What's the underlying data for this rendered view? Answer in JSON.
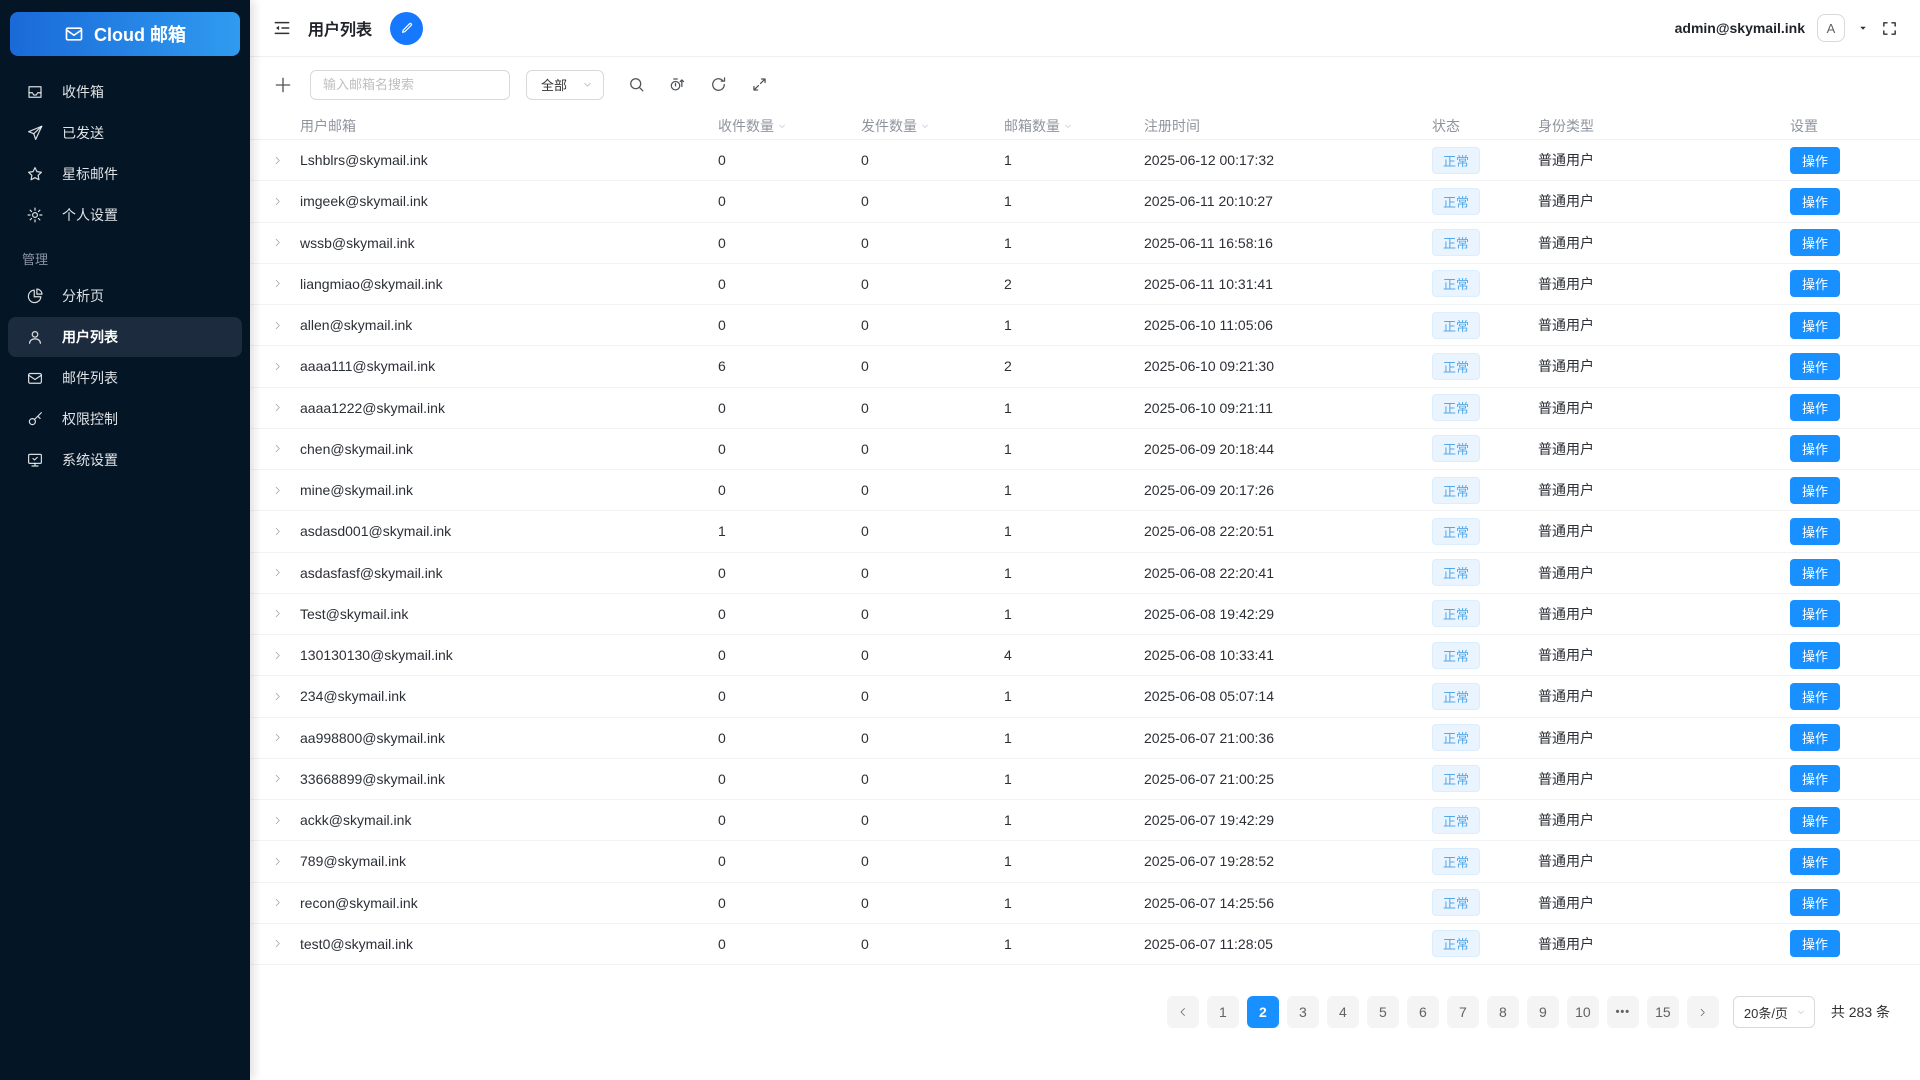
{
  "colors": {
    "accent_blue": "#1890ff",
    "edit_button_blue": "#1677ff",
    "sidebar_bg": "#041526",
    "sidebar_active_bg": "#1c2c3e",
    "logo_gradient_start": "#1a6ad8",
    "logo_gradient_end": "#2f9bf0",
    "status_badge_bg": "#e9f4ff",
    "status_badge_text": "#54a8e8",
    "header_text_gray": "#8f959e"
  },
  "brand": {
    "logo_label": "Cloud 邮箱",
    "logo_icon": "envelope-icon"
  },
  "sidebar": {
    "items": [
      {
        "label": "收件箱",
        "icon": "inbox-icon",
        "active": false
      },
      {
        "label": "已发送",
        "icon": "send-icon",
        "active": false
      },
      {
        "label": "星标邮件",
        "icon": "star-icon",
        "active": false
      },
      {
        "label": "个人设置",
        "icon": "gear-icon",
        "active": false
      }
    ],
    "section_label": "管理",
    "admin_items": [
      {
        "label": "分析页",
        "icon": "pie-chart-icon",
        "active": false
      },
      {
        "label": "用户列表",
        "icon": "user-icon",
        "active": true
      },
      {
        "label": "邮件列表",
        "icon": "mail-list-icon",
        "active": false
      },
      {
        "label": "权限控制",
        "icon": "key-icon",
        "active": false
      },
      {
        "label": "系统设置",
        "icon": "monitor-icon",
        "active": false
      }
    ]
  },
  "topbar": {
    "title": "用户列表",
    "account_email": "admin@skymail.ink",
    "avatar_letter": "A"
  },
  "toolbar": {
    "search_placeholder": "输入邮箱名搜索",
    "filter_value": "全部",
    "icons": [
      "search-icon",
      "timer-sort-icon",
      "refresh-icon",
      "expand-icon"
    ]
  },
  "table": {
    "headers": [
      {
        "label": "用户邮箱",
        "sortable": false
      },
      {
        "label": "收件数量",
        "sortable": true
      },
      {
        "label": "发件数量",
        "sortable": true
      },
      {
        "label": "邮箱数量",
        "sortable": true
      },
      {
        "label": "注册时间",
        "sortable": false
      },
      {
        "label": "状态",
        "sortable": false
      },
      {
        "label": "身份类型",
        "sortable": false
      },
      {
        "label": "设置",
        "sortable": false
      }
    ],
    "action_label": "操作",
    "rows": [
      {
        "email": "Lshblrs@skymail.ink",
        "received": "0",
        "sent": "0",
        "mailboxes": "1",
        "registered_at": "2025-06-12 00:17:32",
        "status": "正常",
        "role": "普通用户"
      },
      {
        "email": "imgeek@skymail.ink",
        "received": "0",
        "sent": "0",
        "mailboxes": "1",
        "registered_at": "2025-06-11 20:10:27",
        "status": "正常",
        "role": "普通用户"
      },
      {
        "email": "wssb@skymail.ink",
        "received": "0",
        "sent": "0",
        "mailboxes": "1",
        "registered_at": "2025-06-11 16:58:16",
        "status": "正常",
        "role": "普通用户"
      },
      {
        "email": "liangmiao@skymail.ink",
        "received": "0",
        "sent": "0",
        "mailboxes": "2",
        "registered_at": "2025-06-11 10:31:41",
        "status": "正常",
        "role": "普通用户"
      },
      {
        "email": "allen@skymail.ink",
        "received": "0",
        "sent": "0",
        "mailboxes": "1",
        "registered_at": "2025-06-10 11:05:06",
        "status": "正常",
        "role": "普通用户"
      },
      {
        "email": "aaaa111@skymail.ink",
        "received": "6",
        "sent": "0",
        "mailboxes": "2",
        "registered_at": "2025-06-10 09:21:30",
        "status": "正常",
        "role": "普通用户"
      },
      {
        "email": "aaaa1222@skymail.ink",
        "received": "0",
        "sent": "0",
        "mailboxes": "1",
        "registered_at": "2025-06-10 09:21:11",
        "status": "正常",
        "role": "普通用户"
      },
      {
        "email": "chen@skymail.ink",
        "received": "0",
        "sent": "0",
        "mailboxes": "1",
        "registered_at": "2025-06-09 20:18:44",
        "status": "正常",
        "role": "普通用户"
      },
      {
        "email": "mine@skymail.ink",
        "received": "0",
        "sent": "0",
        "mailboxes": "1",
        "registered_at": "2025-06-09 20:17:26",
        "status": "正常",
        "role": "普通用户"
      },
      {
        "email": "asdasd001@skymail.ink",
        "received": "1",
        "sent": "0",
        "mailboxes": "1",
        "registered_at": "2025-06-08 22:20:51",
        "status": "正常",
        "role": "普通用户"
      },
      {
        "email": "asdasfasf@skymail.ink",
        "received": "0",
        "sent": "0",
        "mailboxes": "1",
        "registered_at": "2025-06-08 22:20:41",
        "status": "正常",
        "role": "普通用户"
      },
      {
        "email": "Test@skymail.ink",
        "received": "0",
        "sent": "0",
        "mailboxes": "1",
        "registered_at": "2025-06-08 19:42:29",
        "status": "正常",
        "role": "普通用户"
      },
      {
        "email": "130130130@skymail.ink",
        "received": "0",
        "sent": "0",
        "mailboxes": "4",
        "registered_at": "2025-06-08 10:33:41",
        "status": "正常",
        "role": "普通用户"
      },
      {
        "email": "234@skymail.ink",
        "received": "0",
        "sent": "0",
        "mailboxes": "1",
        "registered_at": "2025-06-08 05:07:14",
        "status": "正常",
        "role": "普通用户"
      },
      {
        "email": "aa998800@skymail.ink",
        "received": "0",
        "sent": "0",
        "mailboxes": "1",
        "registered_at": "2025-06-07 21:00:36",
        "status": "正常",
        "role": "普通用户"
      },
      {
        "email": "33668899@skymail.ink",
        "received": "0",
        "sent": "0",
        "mailboxes": "1",
        "registered_at": "2025-06-07 21:00:25",
        "status": "正常",
        "role": "普通用户"
      },
      {
        "email": "ackk@skymail.ink",
        "received": "0",
        "sent": "0",
        "mailboxes": "1",
        "registered_at": "2025-06-07 19:42:29",
        "status": "正常",
        "role": "普通用户"
      },
      {
        "email": "789@skymail.ink",
        "received": "0",
        "sent": "0",
        "mailboxes": "1",
        "registered_at": "2025-06-07 19:28:52",
        "status": "正常",
        "role": "普通用户"
      },
      {
        "email": "recon@skymail.ink",
        "received": "0",
        "sent": "0",
        "mailboxes": "1",
        "registered_at": "2025-06-07 14:25:56",
        "status": "正常",
        "role": "普通用户"
      },
      {
        "email": "test0@skymail.ink",
        "received": "0",
        "sent": "0",
        "mailboxes": "1",
        "registered_at": "2025-06-07 11:28:05",
        "status": "正常",
        "role": "普通用户"
      }
    ]
  },
  "pagination": {
    "pages": [
      "1",
      "2",
      "3",
      "4",
      "5",
      "6",
      "7",
      "8",
      "9",
      "10"
    ],
    "active_page": "2",
    "ellipsis": "•••",
    "trailing_page": "15",
    "page_size_label": "20条/页",
    "total_label": "共 283 条"
  }
}
